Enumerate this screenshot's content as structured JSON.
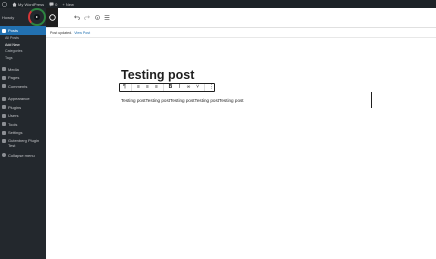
{
  "adminbar": {
    "site_name": "My WordPress",
    "comments": "0",
    "new_label": "+ New"
  },
  "sidebar": {
    "user": "Howdy",
    "items": [
      {
        "label": "Posts",
        "active": true
      },
      {
        "label": "Media"
      },
      {
        "label": "Pages"
      },
      {
        "label": "Comments"
      },
      {
        "label": "Appearance"
      },
      {
        "label": "Plugins"
      },
      {
        "label": "Users"
      },
      {
        "label": "Tools"
      },
      {
        "label": "Settings"
      },
      {
        "label": "Gutenberg Plugin Test"
      },
      {
        "label": "Collapse menu"
      }
    ],
    "subitems": [
      "All Posts",
      "Add New",
      "Categories",
      "Tags"
    ]
  },
  "editor": {
    "notice_text": "Post updated.",
    "notice_link": "View Post",
    "title": "Testing post",
    "paragraph": "Testing postTesting postTesting postTesting postTesting post"
  },
  "colors": {
    "admin_dark": "#1d2327",
    "sidebar": "#23282d",
    "accent": "#2271b1"
  }
}
